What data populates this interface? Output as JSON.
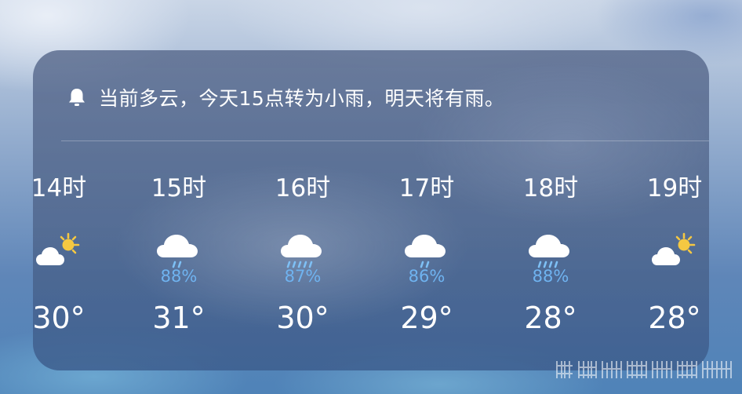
{
  "alert": {
    "icon": "bell-icon",
    "text": "当前多云，今天15点转为小雨，明天将有雨。"
  },
  "hourly": [
    {
      "time": "14时",
      "icon": "partly-cloudy-sun-icon",
      "precip": "",
      "temp": "30°"
    },
    {
      "time": "15时",
      "icon": "light-rain-icon",
      "precip": "88%",
      "temp": "31°"
    },
    {
      "time": "16时",
      "icon": "rain-icon",
      "precip": "87%",
      "temp": "30°"
    },
    {
      "time": "17时",
      "icon": "light-rain-icon",
      "precip": "86%",
      "temp": "29°"
    },
    {
      "time": "18时",
      "icon": "rain-icon",
      "precip": "88%",
      "temp": "28°"
    },
    {
      "time": "19时",
      "icon": "partly-cloudy-sun-icon",
      "precip": "",
      "temp": "28°"
    }
  ],
  "colors": {
    "precip_text": "#6fb3f0",
    "rain_drops": "#7ec0f5",
    "sun": "#f5c842"
  }
}
